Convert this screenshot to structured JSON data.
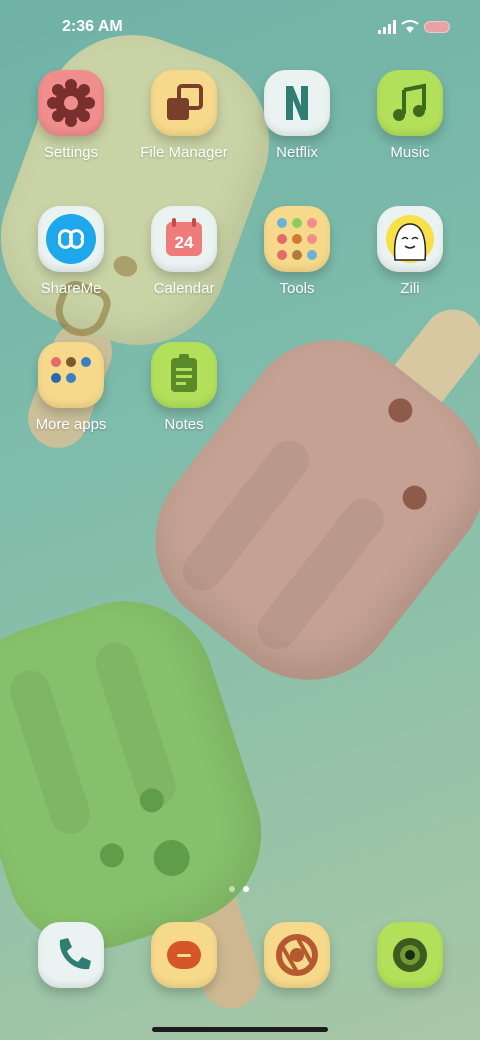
{
  "status": {
    "time": "2:36 AM"
  },
  "apps": [
    {
      "name": "Settings"
    },
    {
      "name": "File Manager"
    },
    {
      "name": "Netflix"
    },
    {
      "name": "Music"
    },
    {
      "name": "ShareMe"
    },
    {
      "name": "Calendar",
      "date": "24"
    },
    {
      "name": "Tools"
    },
    {
      "name": "Zili"
    },
    {
      "name": "More apps"
    },
    {
      "name": "Notes"
    }
  ],
  "dock": [
    {
      "icon": "phone-icon"
    },
    {
      "icon": "messages-icon"
    },
    {
      "icon": "chrome-icon"
    },
    {
      "icon": "camera-icon"
    }
  ],
  "page_indicator": {
    "count": 2,
    "active": 2
  },
  "colors": {
    "accent_pink": "#f08d8d",
    "accent_yellow": "#f6d98b",
    "accent_lime": "#b2e05a",
    "icon_white": "#eaf3f1"
  }
}
